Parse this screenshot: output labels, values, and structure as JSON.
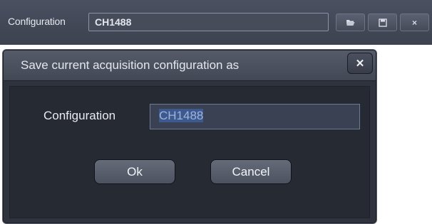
{
  "toolbar": {
    "label": "Configuration",
    "value": "CH1488",
    "buttons": [
      {
        "name": "open-folder-button",
        "icon": "folder-open-icon"
      },
      {
        "name": "save-button",
        "icon": "floppy-disk-icon"
      },
      {
        "name": "delete-button",
        "icon": "close-icon",
        "glyph": "×"
      }
    ]
  },
  "dialog": {
    "title": "Save current acquisition configuration as",
    "close_glyph": "✕",
    "field_label": "Configuration",
    "field_value": "CH1488",
    "ok_label": "Ok",
    "cancel_label": "Cancel"
  },
  "colors": {
    "background": "#2f333d",
    "selection": "#3d5a8f",
    "text": "#e8ebf1"
  }
}
